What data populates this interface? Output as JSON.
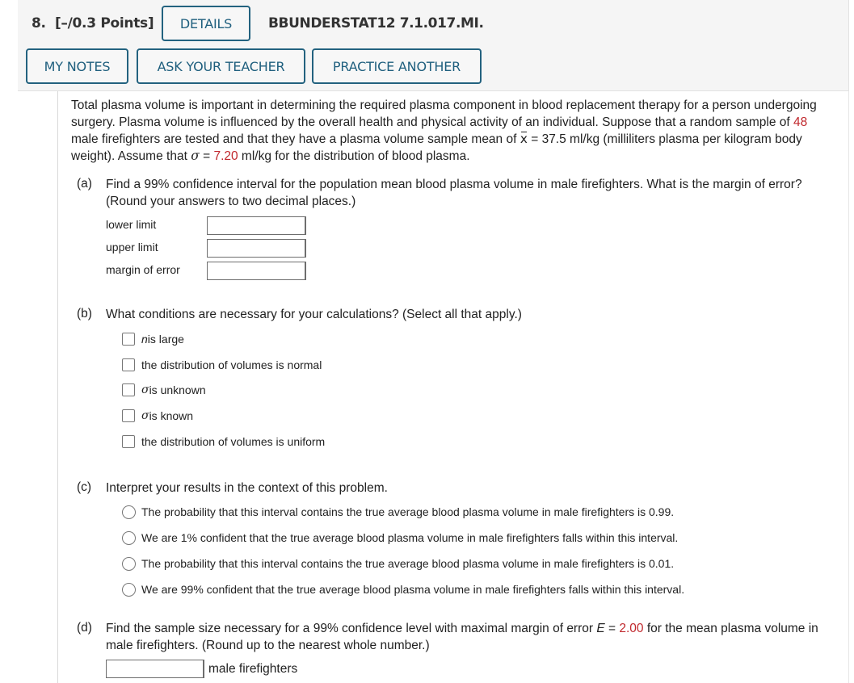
{
  "header": {
    "question_number": "8.",
    "points": "[–/0.3 Points]",
    "details_label": "DETAILS",
    "problem_code": "BBUNDERSTAT12 7.1.017.MI.",
    "my_notes_label": "MY NOTES",
    "ask_teacher_label": "ASK YOUR TEACHER",
    "practice_another_label": "PRACTICE ANOTHER",
    "button_color": "#23627f"
  },
  "intro": {
    "line1": "Total plasma volume is important in determining the required plasma component in blood replacement therapy for a person undergoing",
    "line2a": "surgery. Plasma volume is influenced by the overall health and physical activity of an individual. Suppose that a random sample of ",
    "sample_size": "48",
    "line3a": "male firefighters are tested and that they have a plasma volume sample mean of ",
    "xbar_symbol": "x",
    "line3b": " = 37.5 ml/kg (milliliters plasma per kilogram body",
    "line4a": "weight). Assume that ",
    "sigma_symbol": "σ",
    "line4b": " = ",
    "sigma_value": "7.20",
    "line4c": " ml/kg for the distribution of blood plasma.",
    "highlight_color": "#c0282d"
  },
  "part_a": {
    "label": "(a)",
    "line1": "Find a 99% confidence interval for the population mean blood plasma volume in male firefighters. What is the margin of error?",
    "line2": "(Round your answers to two decimal places.)",
    "fields": [
      {
        "label": "lower limit",
        "value": ""
      },
      {
        "label": "upper limit",
        "value": ""
      },
      {
        "label": "margin of error",
        "value": ""
      }
    ]
  },
  "part_b": {
    "label": "(b)",
    "question": "What conditions are necessary for your calculations? (Select all that apply.)",
    "options": [
      {
        "prefix": "n",
        "text": " is large",
        "checked": false
      },
      {
        "prefix": "",
        "text": "the distribution of volumes is normal",
        "checked": false
      },
      {
        "prefix": "σ",
        "text": " is unknown",
        "checked": false
      },
      {
        "prefix": "σ",
        "text": " is known",
        "checked": false
      },
      {
        "prefix": "",
        "text": "the distribution of volumes is uniform",
        "checked": false
      }
    ]
  },
  "part_c": {
    "label": "(c)",
    "question": "Interpret your results in the context of this problem.",
    "options": [
      {
        "text": "The probability that this interval contains the true average blood plasma volume in male firefighters is 0.99.",
        "selected": false
      },
      {
        "text": "We are 1% confident that the true average blood plasma volume in male firefighters falls within this interval.",
        "selected": false
      },
      {
        "text": "The probability that this interval contains the true average blood plasma volume in male firefighters is 0.01.",
        "selected": false
      },
      {
        "text": "We are 99% confident that the true average blood plasma volume in male firefighters falls within this interval.",
        "selected": false
      }
    ]
  },
  "part_d": {
    "label": "(d)",
    "line1a": "Find the sample size necessary for a 99% confidence level with maximal margin of error ",
    "e_symbol": "E",
    "line1b": " = ",
    "e_value": "2.00",
    "line1c": " for the mean plasma volume in",
    "line2": "male firefighters. (Round up to the nearest whole number.)",
    "input_value": "",
    "unit_label": "male firefighters"
  }
}
